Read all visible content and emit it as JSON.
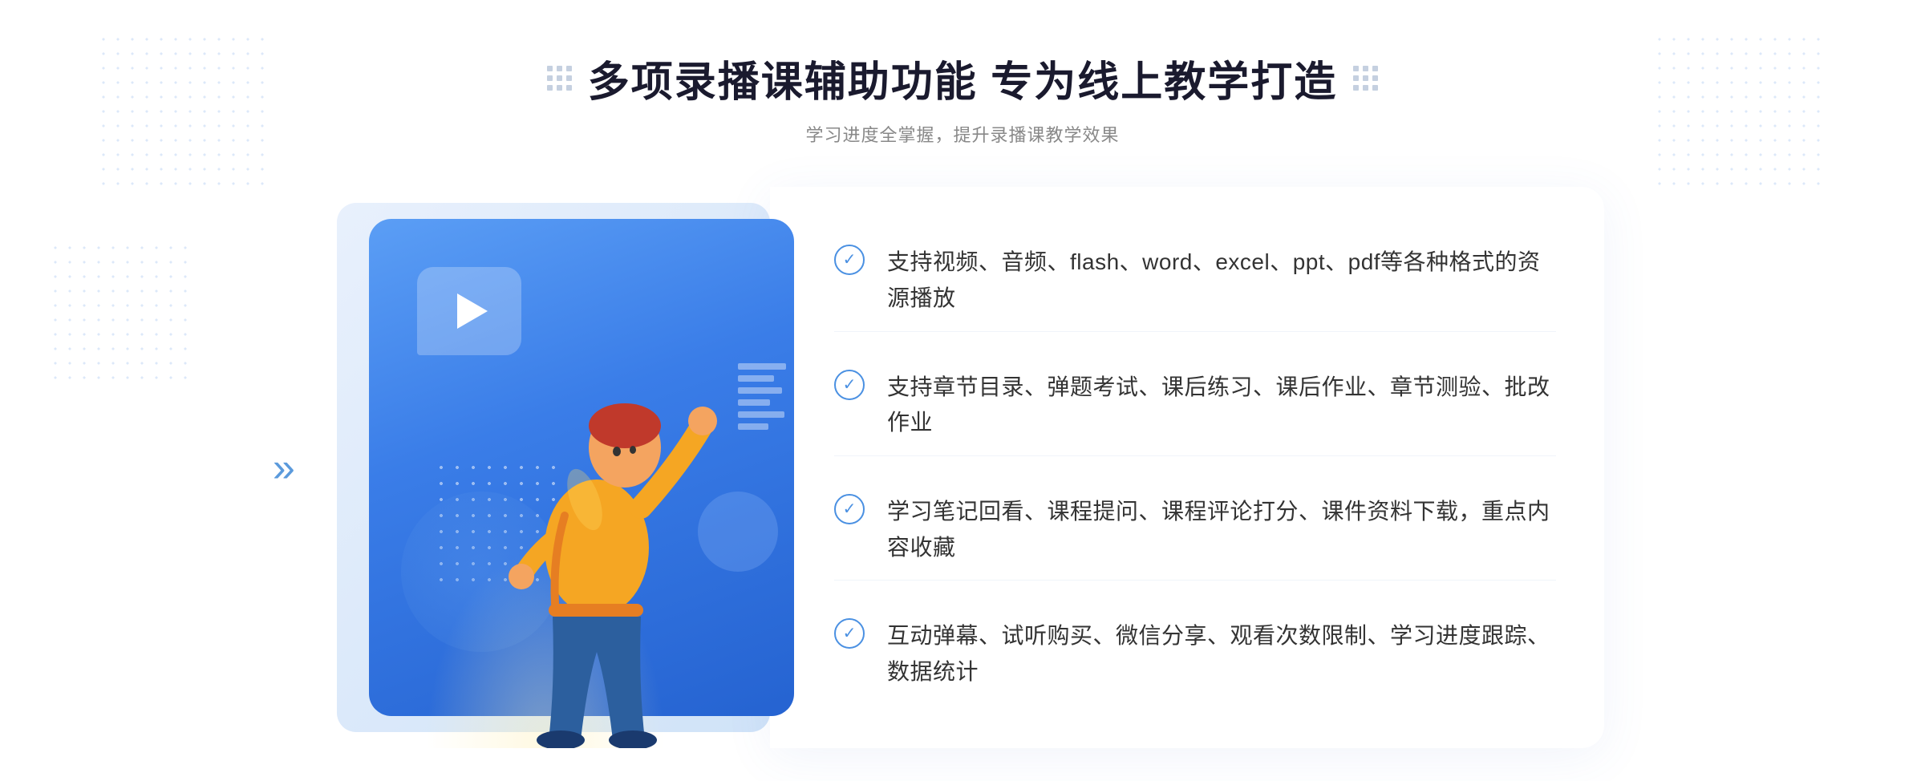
{
  "header": {
    "title": "多项录播课辅助功能 专为线上教学打造",
    "subtitle": "学习进度全掌握，提升录播课教学效果",
    "title_dots_label": "decorative dots"
  },
  "features": [
    {
      "id": 1,
      "text": "支持视频、音频、flash、word、excel、ppt、pdf等各种格式的资源播放"
    },
    {
      "id": 2,
      "text": "支持章节目录、弹题考试、课后练习、课后作业、章节测验、批改作业"
    },
    {
      "id": 3,
      "text": "学习笔记回看、课程提问、课程评论打分、课件资料下载，重点内容收藏"
    },
    {
      "id": 4,
      "text": "互动弹幕、试听购买、微信分享、观看次数限制、学习进度跟踪、数据统计"
    }
  ],
  "colors": {
    "blue_primary": "#3a7de8",
    "blue_light": "#5b9ef5",
    "blue_accent": "#4a90e2",
    "text_dark": "#1a1a2e",
    "text_gray": "#888888",
    "text_body": "#333333"
  },
  "icons": {
    "check": "✓",
    "play": "▶",
    "chevron_right": "»"
  }
}
